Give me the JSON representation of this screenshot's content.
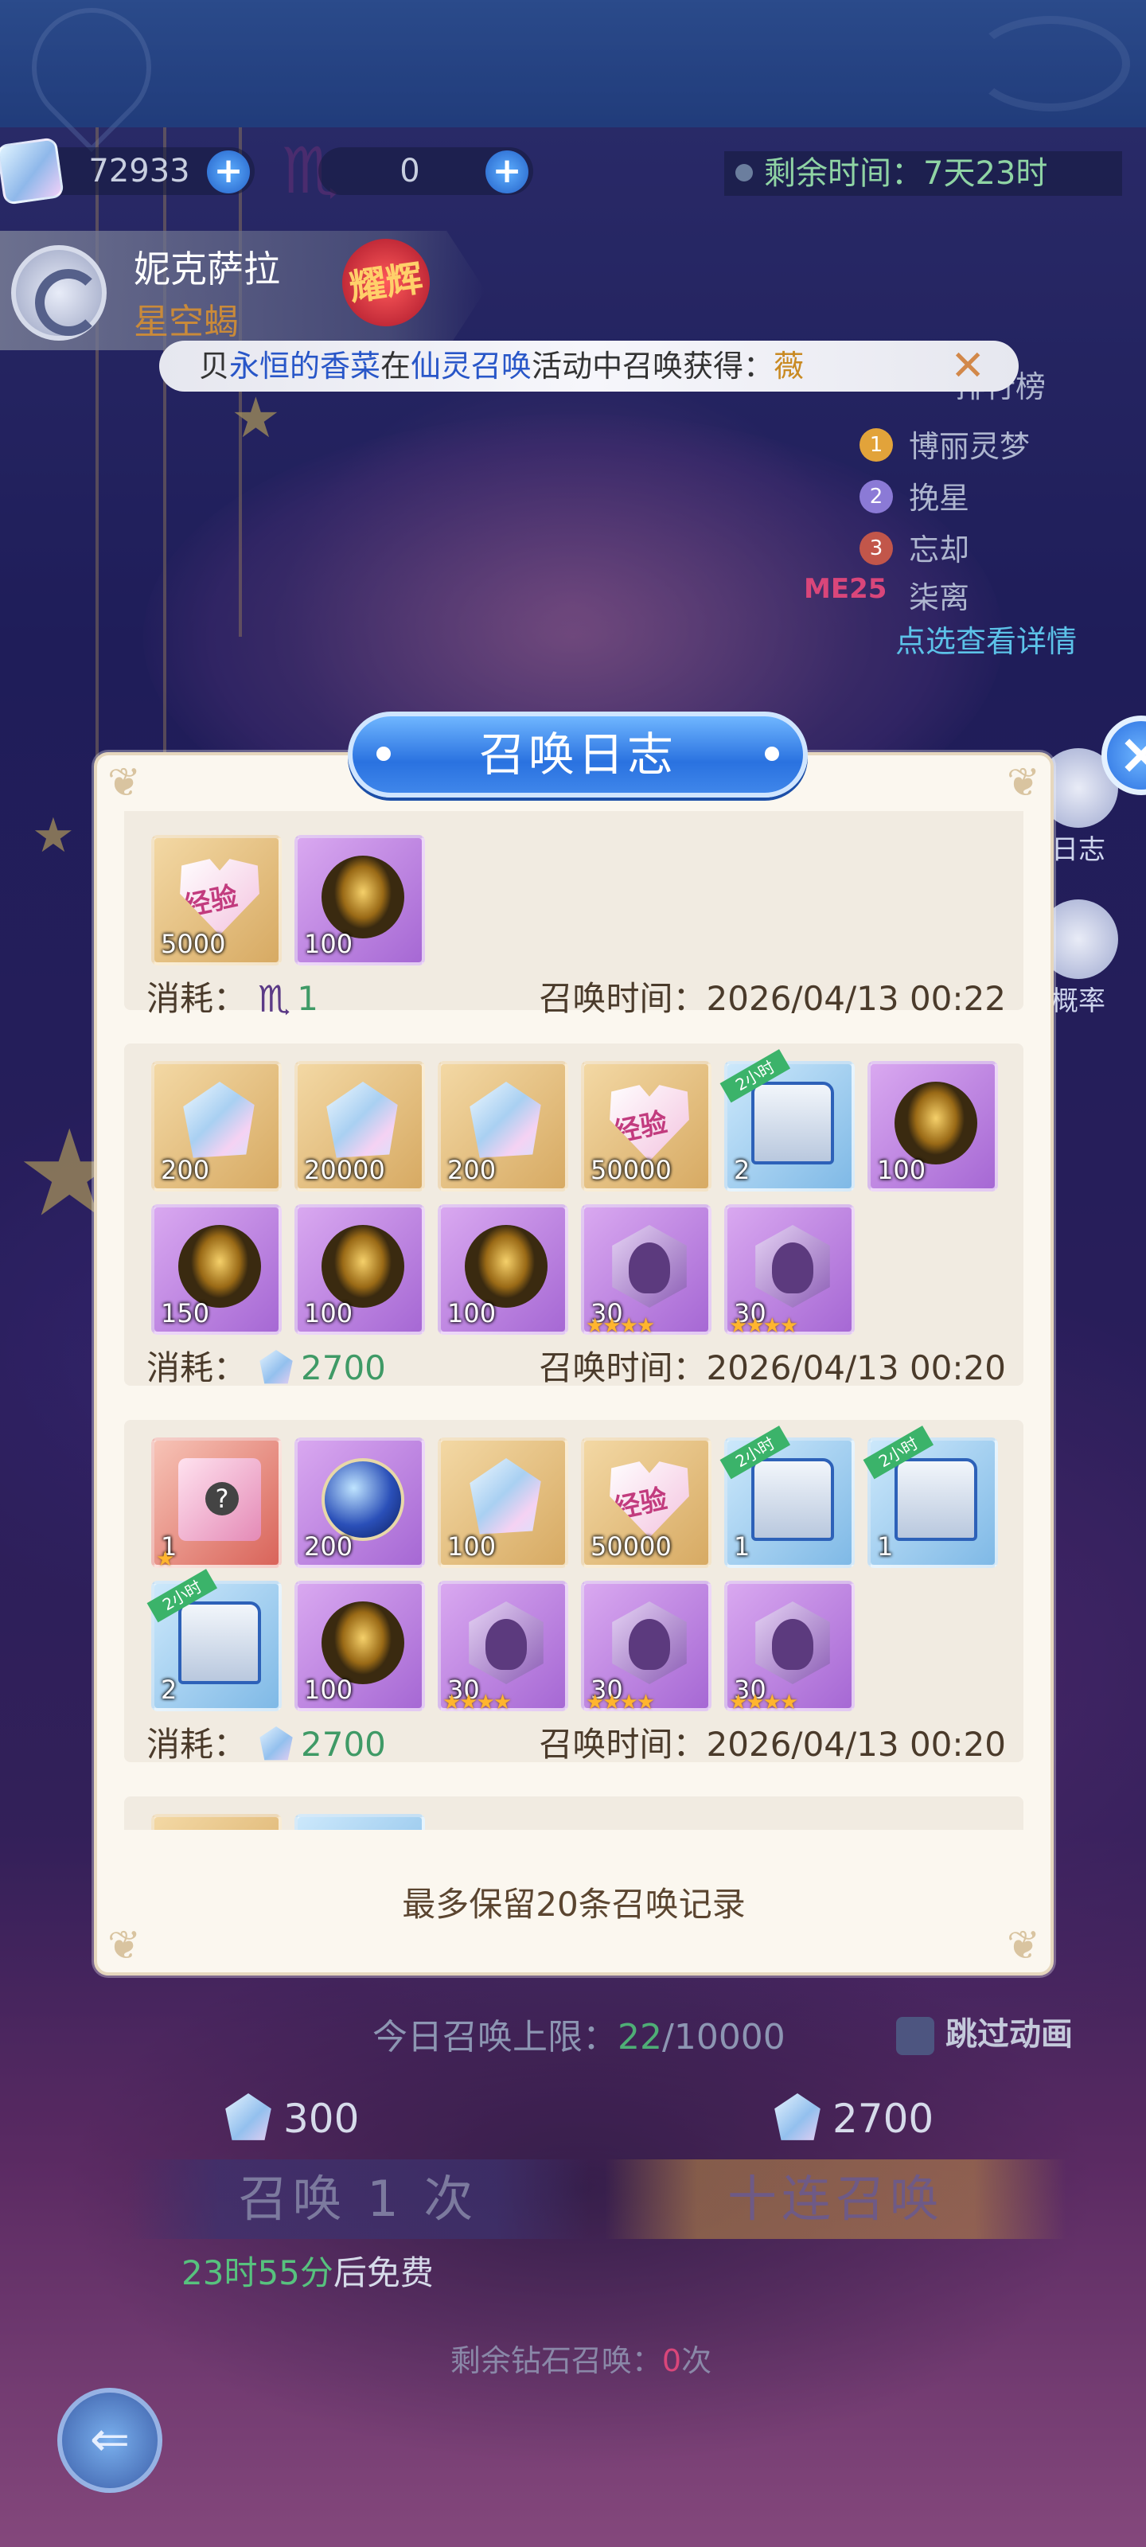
{
  "currency": {
    "diamond_value": "72933",
    "scorpion_value": "0"
  },
  "timer": {
    "label": "剩余时间：",
    "value": "7天23时"
  },
  "character": {
    "name": "妮克萨拉",
    "subtitle": "星空蝎",
    "badge": "耀辉"
  },
  "ticker": {
    "prefix": "贝",
    "player": "永恒的香菜",
    "mid1": "在",
    "activity": "仙灵召唤",
    "mid2": "活动中召唤获得：",
    "reward": "薇"
  },
  "ranking": {
    "title": "排行榜",
    "entries": [
      {
        "rank": "1",
        "name": "博丽灵梦",
        "color": "#e2a33a"
      },
      {
        "rank": "2",
        "name": "挽星",
        "color": "#8b7ad6"
      },
      {
        "rank": "3",
        "name": "忘却",
        "color": "#c2564a"
      }
    ],
    "me_label": "ME",
    "me_rank": "25",
    "me_name": "柒离",
    "detail_link": "点选查看详情"
  },
  "side_buttons": {
    "log_label": "日志",
    "rate_label": "概率"
  },
  "modal": {
    "title": "召唤日志",
    "cost_label": "消耗：",
    "time_label": "召唤时间：",
    "entries": [
      {
        "cost": "1",
        "cost_type": "scorpion",
        "time": "2026/04/13 00:22",
        "items": [
          {
            "icon": "exp",
            "bg": "gold",
            "qty": "5000"
          },
          {
            "icon": "egg",
            "bg": "purple",
            "qty": "100"
          }
        ]
      },
      {
        "cost": "2700",
        "cost_type": "diamond",
        "time": "2026/04/13 00:20",
        "items": [
          {
            "icon": "gem",
            "bg": "gold",
            "qty": "200"
          },
          {
            "icon": "gem",
            "bg": "gold",
            "qty": "20000"
          },
          {
            "icon": "gem",
            "bg": "gold",
            "qty": "200"
          },
          {
            "icon": "exp",
            "bg": "gold",
            "qty": "50000"
          },
          {
            "icon": "chest",
            "bg": "blue",
            "qty": "2",
            "tag": "2小时"
          },
          {
            "icon": "egg",
            "bg": "purple",
            "qty": "100"
          },
          {
            "icon": "egg",
            "bg": "purple",
            "qty": "150"
          },
          {
            "icon": "egg",
            "bg": "purple",
            "qty": "100"
          },
          {
            "icon": "egg",
            "bg": "purple",
            "qty": "100"
          },
          {
            "icon": "shard",
            "bg": "purple",
            "qty": "30",
            "stars": "★★★★"
          },
          {
            "icon": "shard",
            "bg": "purple",
            "qty": "30",
            "stars": "★★★★"
          }
        ]
      },
      {
        "cost": "2700",
        "cost_type": "diamond",
        "time": "2026/04/13 00:20",
        "items": [
          {
            "icon": "box",
            "bg": "red",
            "qty": "1",
            "stars": "★"
          },
          {
            "icon": "orb",
            "bg": "purple",
            "qty": "200"
          },
          {
            "icon": "gem",
            "bg": "gold",
            "qty": "100"
          },
          {
            "icon": "exp",
            "bg": "gold",
            "qty": "50000"
          },
          {
            "icon": "chest",
            "bg": "blue",
            "qty": "1",
            "tag": "2小时"
          },
          {
            "icon": "chest",
            "bg": "blue",
            "qty": "1",
            "tag": "2小时"
          },
          {
            "icon": "chest",
            "bg": "blue",
            "qty": "2",
            "tag": "2小时"
          },
          {
            "icon": "egg",
            "bg": "purple",
            "qty": "100"
          },
          {
            "icon": "shard",
            "bg": "purple",
            "qty": "30",
            "stars": "★★★★"
          },
          {
            "icon": "shard",
            "bg": "purple",
            "qty": "30",
            "stars": "★★★★"
          },
          {
            "icon": "shard",
            "bg": "purple",
            "qty": "30",
            "stars": "★★★★"
          }
        ]
      },
      {
        "cost": "",
        "cost_type": "none",
        "time": "",
        "items": [
          {
            "icon": "gem",
            "bg": "gold",
            "qty": ""
          },
          {
            "icon": "chest",
            "bg": "blue",
            "qty": ""
          }
        ]
      }
    ],
    "retain_note": "最多保留20条召唤记录"
  },
  "summon": {
    "limit_label": "今日召唤上限：",
    "limit_used": "22",
    "limit_total": "/10000",
    "skip_label": "跳过动画",
    "single_price": "300",
    "ten_price": "2700",
    "single_label": "召唤 1 次",
    "ten_label": "十连召唤",
    "free_time": "23时55分",
    "free_suffix": "后免费",
    "remain_prefix": "剩余钻石召唤：",
    "remain_count": "0",
    "remain_suffix": "次"
  }
}
